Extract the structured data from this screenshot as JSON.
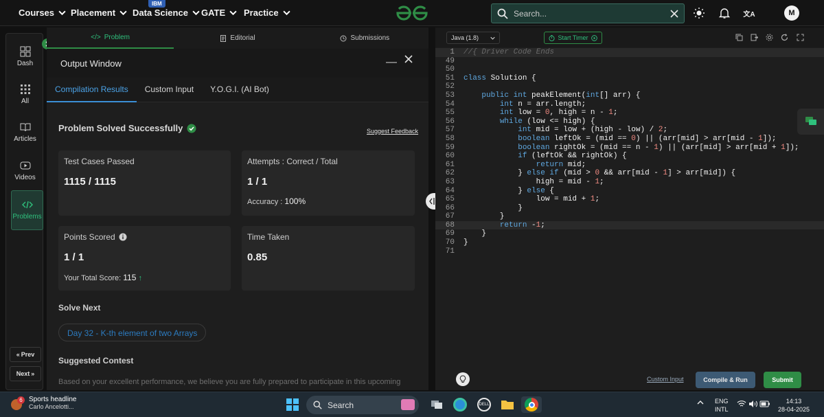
{
  "topnav": {
    "items": [
      "Courses",
      "Placement",
      "Data Science",
      "GATE",
      "Practice"
    ],
    "ibm_badge": "IBM",
    "search_placeholder": "Search...",
    "avatar_initial": "M",
    "translate_glyph": "文A"
  },
  "sidebar": {
    "items": [
      {
        "label": "Dash",
        "icon": "dashboard-icon"
      },
      {
        "label": "All",
        "icon": "grid-icon"
      },
      {
        "label": "Articles",
        "icon": "book-icon"
      },
      {
        "label": "Videos",
        "icon": "video-icon"
      },
      {
        "label": "Problems",
        "icon": "code-icon",
        "active": true
      }
    ],
    "prev_label": "Prev",
    "next_label": "Next"
  },
  "problem_tabs": [
    {
      "label": "Problem",
      "active": true
    },
    {
      "label": "Editorial"
    },
    {
      "label": "Submissions"
    }
  ],
  "output_window": {
    "title": "Output Window",
    "tabs": [
      {
        "label": "Compilation Results",
        "active": true
      },
      {
        "label": "Custom Input"
      },
      {
        "label": "Y.O.G.I. (AI Bot)"
      }
    ],
    "status": "Problem Solved Successfully",
    "suggest_feedback": "Suggest Feedback",
    "test_cases": {
      "label": "Test Cases Passed",
      "value": "1115 / 1115"
    },
    "attempts": {
      "label": "Attempts : Correct / Total",
      "value": "1 / 1",
      "accuracy_label": "Accuracy :",
      "accuracy_value": "100%"
    },
    "points": {
      "label": "Points Scored",
      "value": "1 / 1",
      "total_label": "Your Total Score:",
      "total_value": "115"
    },
    "time": {
      "label": "Time Taken",
      "value": "0.85"
    },
    "solve_next_heading": "Solve Next",
    "solve_next_item": "Day 32 - K-th element of two Arrays",
    "suggested_contest_heading": "Suggested Contest",
    "contest_note": "Based on your excellent performance, we believe you are fully prepared to participate in this upcoming"
  },
  "editor": {
    "language": "Java (1.8)",
    "timer_label": "Start Timer",
    "code_lines": [
      {
        "n": "1",
        "html": "<span class=\"cm\">//{ Driver Code Ends</span>",
        "hl": true
      },
      {
        "n": "49",
        "html": ""
      },
      {
        "n": "50",
        "html": ""
      },
      {
        "n": "51",
        "html": "<span class=\"kw\">class</span> Solution {"
      },
      {
        "n": "52",
        "html": ""
      },
      {
        "n": "53",
        "html": "    <span class=\"kw\">public int</span> peakElement(<span class=\"kw\">int</span>[] arr) {"
      },
      {
        "n": "54",
        "html": "        <span class=\"kw\">int</span> n = arr.length;"
      },
      {
        "n": "55",
        "html": "        <span class=\"kw\">int</span> low = <span class=\"num\">0</span>, high = n - <span class=\"num\">1</span>;"
      },
      {
        "n": "56",
        "html": "        <span class=\"kw\">while</span> (low &lt;= high) {"
      },
      {
        "n": "57",
        "html": "            <span class=\"kw\">int</span> mid = low + (high - low) / <span class=\"num\">2</span>;"
      },
      {
        "n": "58",
        "html": "            <span class=\"kw\">boolean</span> leftOk = (mid == <span class=\"num\">0</span>) || (arr[mid] &gt; arr[mid - <span class=\"num\">1</span>]);"
      },
      {
        "n": "59",
        "html": "            <span class=\"kw\">boolean</span> rightOk = (mid == n - <span class=\"num\">1</span>) || (arr[mid] &gt; arr[mid + <span class=\"num\">1</span>]);"
      },
      {
        "n": "60",
        "html": "            <span class=\"kw\">if</span> (leftOk &amp;&amp; rightOk) {"
      },
      {
        "n": "61",
        "html": "                <span class=\"kw\">return</span> mid;"
      },
      {
        "n": "62",
        "html": "            } <span class=\"kw\">else if</span> (mid &gt; <span class=\"num\">0</span> &amp;&amp; arr[mid - <span class=\"num\">1</span>] &gt; arr[mid]) {"
      },
      {
        "n": "63",
        "html": "                high = mid - <span class=\"num\">1</span>;"
      },
      {
        "n": "64",
        "html": "            } <span class=\"kw\">else</span> {"
      },
      {
        "n": "65",
        "html": "                low = mid + <span class=\"num\">1</span>;"
      },
      {
        "n": "66",
        "html": "            }"
      },
      {
        "n": "67",
        "html": "        }"
      },
      {
        "n": "68",
        "html": "        <span class=\"kw\">return</span> -<span class=\"num\">1</span>;",
        "hl": true
      },
      {
        "n": "69",
        "html": "    }"
      },
      {
        "n": "70",
        "html": "}"
      },
      {
        "n": "71",
        "html": ""
      }
    ],
    "custom_input_label": "Custom Input",
    "compile_run_label": "Compile & Run",
    "submit_label": "Submit"
  },
  "taskbar": {
    "news_badge": "6",
    "news_title": "Sports headline",
    "news_sub": "Carlo Ancelotti...",
    "search_label": "Search",
    "lang_top": "ENG",
    "lang_bottom": "INTL",
    "time": "14:13",
    "date": "28-04-2025"
  },
  "colors": {
    "brand_green": "#2f8d46",
    "accent_blue": "#3b8fd6",
    "success_green": "#2fc17d"
  }
}
